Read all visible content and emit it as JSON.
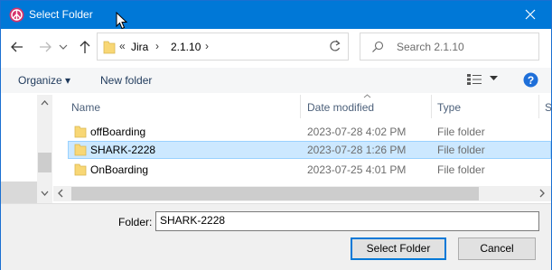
{
  "window": {
    "title": "Select Folder"
  },
  "address": {
    "overflow": "«",
    "crumbs": [
      "Jira",
      "2.1.10"
    ]
  },
  "search": {
    "placeholder": "Search 2.1.10"
  },
  "toolbar": {
    "organize_label": "Organize ▾",
    "new_folder_label": "New folder"
  },
  "columns": {
    "name": "Name",
    "date_modified": "Date modified",
    "type": "Type",
    "size_partial": "S"
  },
  "files": [
    {
      "name": "offBoarding",
      "date": "2023-07-28 4:02 PM",
      "type": "File folder",
      "selected": false
    },
    {
      "name": "SHARK-2228",
      "date": "2023-07-28 1:26 PM",
      "type": "File folder",
      "selected": true
    },
    {
      "name": "OnBoarding",
      "date": "2023-07-25 4:01 PM",
      "type": "File folder",
      "selected": false
    }
  ],
  "footer": {
    "folder_label": "Folder:",
    "folder_value": "SHARK-2228",
    "select_button": "Select Folder",
    "cancel_button": "Cancel"
  },
  "colors": {
    "titlebar": "#0078d7",
    "selection": "#cce8ff",
    "folder": "#f8d775"
  }
}
